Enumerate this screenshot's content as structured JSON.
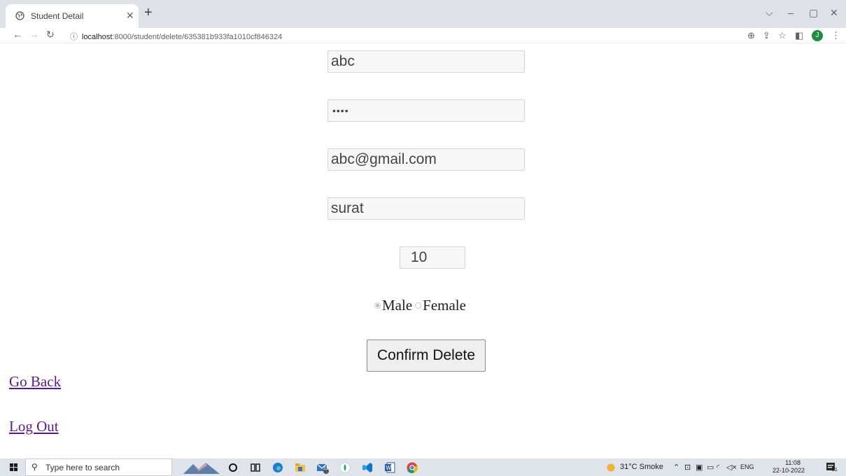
{
  "browser": {
    "tab_title": "Student Detail",
    "url_host": "localhost",
    "url_path": ":8000/student/delete/635381b933fa1010cf846324",
    "avatar_letter": "J"
  },
  "form": {
    "name_value": "abc",
    "password_value": "••••",
    "email_value": "abc@gmail.com",
    "city_value": "surat",
    "number_value": "10",
    "gender_options": [
      "Male",
      "Female"
    ],
    "gender_selected": "Male",
    "confirm_label": "Confirm Delete"
  },
  "links": {
    "go_back": "Go Back",
    "log_out": "Log Out"
  },
  "taskbar": {
    "search_placeholder": "Type here to search",
    "weather": "31°C  Smoke",
    "lang": "ENG",
    "time": "11:08",
    "date": "22-10-2022",
    "notif_count": "21",
    "mail_badge": "12"
  },
  "colors": {
    "link": "#551a8b",
    "avatar": "#1e8e3e",
    "taskbar": "#dfe3ea"
  }
}
